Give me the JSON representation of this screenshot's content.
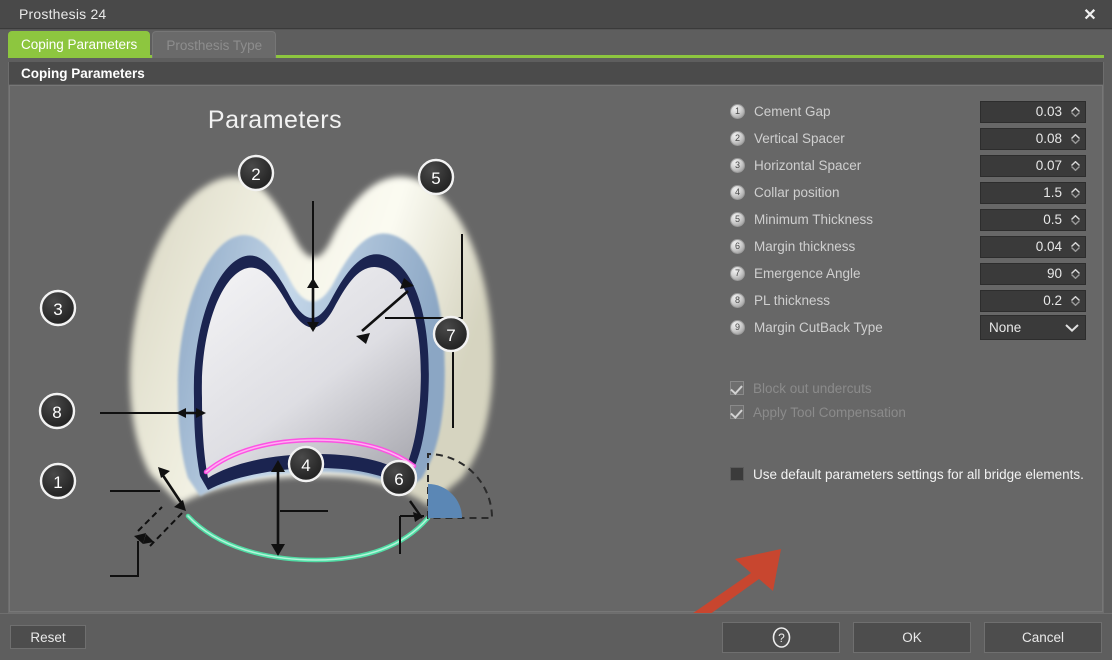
{
  "window": {
    "title": "Prosthesis 24",
    "close_icon": "close-icon"
  },
  "tabs": [
    {
      "label": "Coping Parameters",
      "active": true
    },
    {
      "label": "Prosthesis Type",
      "active": false
    }
  ],
  "group": {
    "header": "Coping Parameters"
  },
  "diagram": {
    "title": "Parameters",
    "callouts": [
      "1",
      "2",
      "3",
      "4",
      "5",
      "6",
      "7",
      "8"
    ],
    "colors": {
      "outer_tooth": "#e9e7d4",
      "spacer_band": "#a9c2dc",
      "inner_core": "#d3d3d8",
      "dark_outline": "#1b2450",
      "margin_line": "#ff4ce4",
      "emergence_line": "#4fe3a8",
      "angle_wedge": "#5b87b5"
    }
  },
  "parameters": [
    {
      "num": "1",
      "label": "Cement Gap",
      "value": "0.03",
      "control": "spinner"
    },
    {
      "num": "2",
      "label": "Vertical Spacer",
      "value": "0.08",
      "control": "spinner"
    },
    {
      "num": "3",
      "label": "Horizontal Spacer",
      "value": "0.07",
      "control": "spinner"
    },
    {
      "num": "4",
      "label": "Collar position",
      "value": "1.5",
      "control": "spinner"
    },
    {
      "num": "5",
      "label": "Minimum Thickness",
      "value": "0.5",
      "control": "spinner"
    },
    {
      "num": "6",
      "label": "Margin thickness",
      "value": "0.04",
      "control": "spinner"
    },
    {
      "num": "7",
      "label": "Emergence Angle",
      "value": "90",
      "control": "spinner"
    },
    {
      "num": "8",
      "label": "PL thickness",
      "value": "0.2",
      "control": "spinner"
    },
    {
      "num": "9",
      "label": "Margin CutBack Type",
      "value": "None",
      "control": "dropdown"
    }
  ],
  "dropdown_options": [
    "None"
  ],
  "checkboxes": [
    {
      "label": "Block out undercuts",
      "checked": true,
      "enabled": false
    },
    {
      "label": "Apply Tool Compensation",
      "checked": true,
      "enabled": false
    }
  ],
  "default_checkbox": {
    "label": "Use default parameters settings for all bridge elements.",
    "checked": false,
    "enabled": true
  },
  "annotation": {
    "type": "red-arrow",
    "color": "#c8462f",
    "points_to": "use-default-parameters-checkbox"
  },
  "footer": {
    "reset_label": "Reset",
    "help_label": "?",
    "ok_label": "OK",
    "cancel_label": "Cancel"
  },
  "theme": {
    "accent_green": "#8dc63f",
    "titlebar_bg": "#494949",
    "panel_bg": "#676767",
    "window_bg": "#5e5e5e",
    "field_bg": "#3a3a3a"
  }
}
